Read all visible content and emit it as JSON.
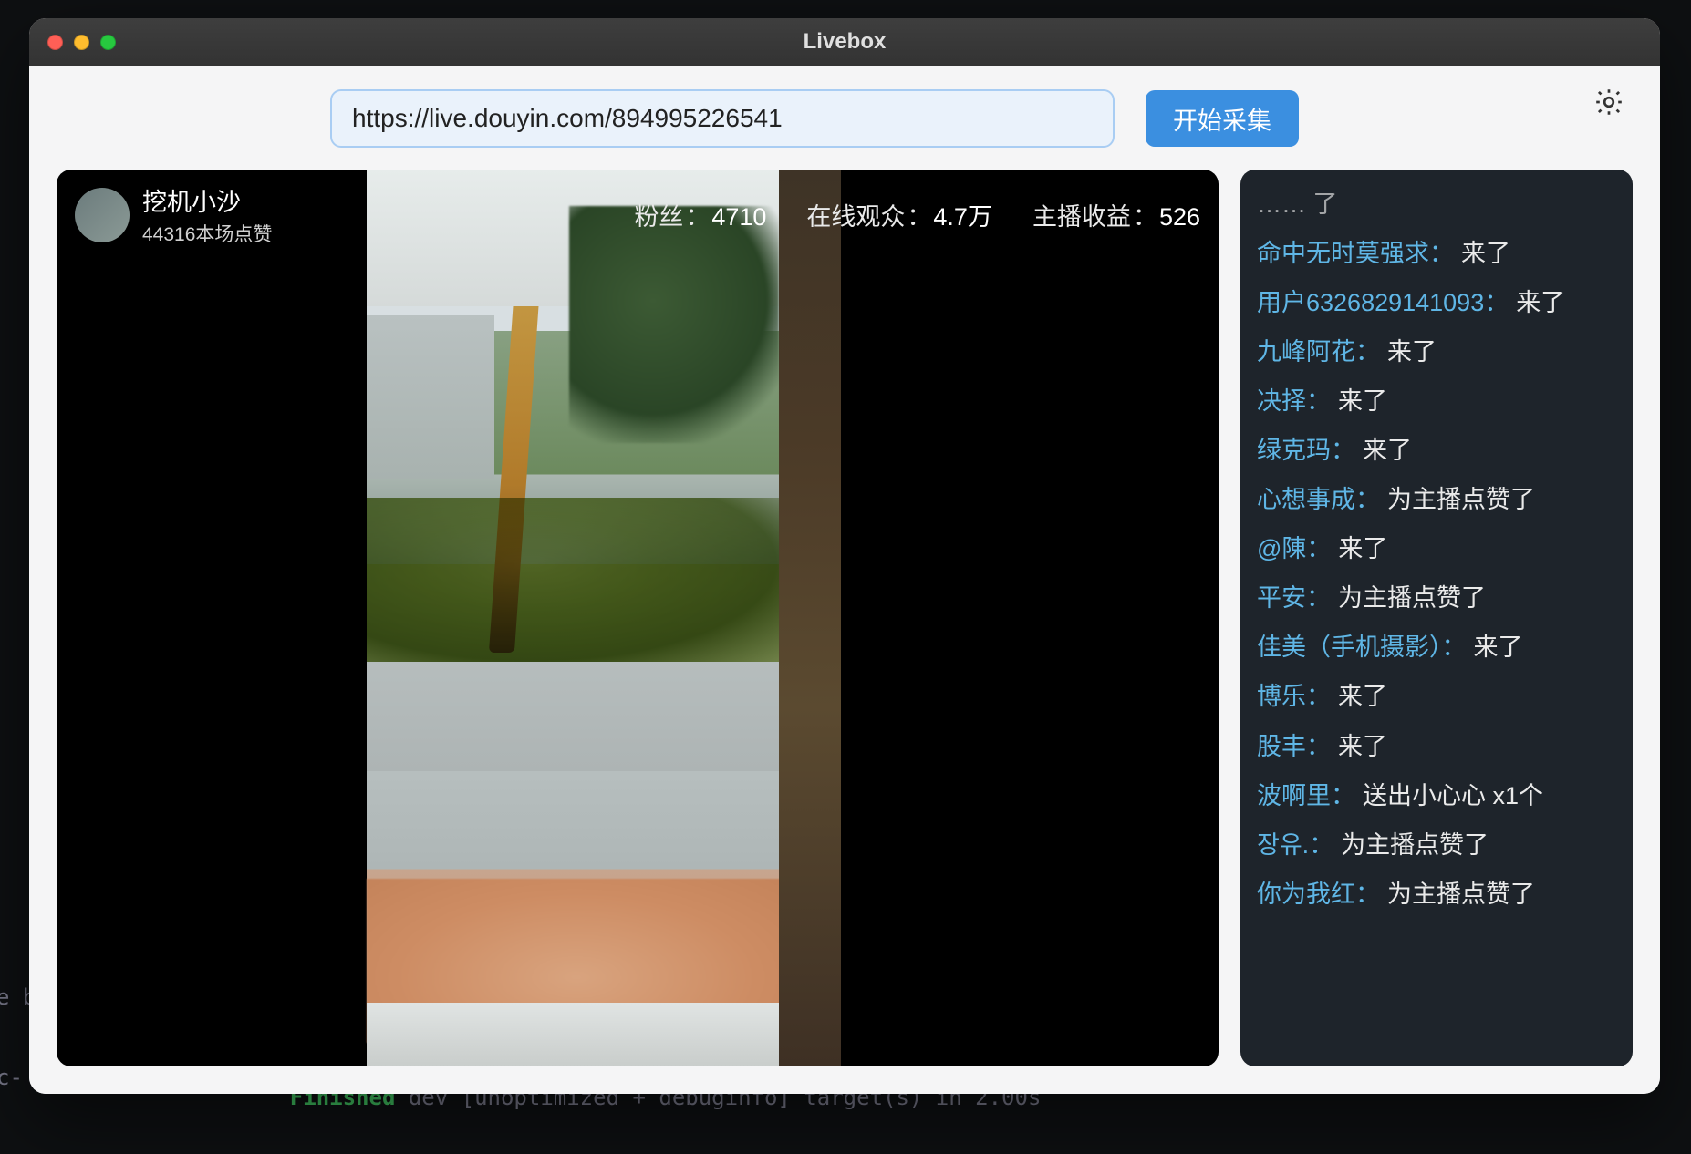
{
  "window": {
    "title": "Livebox"
  },
  "top": {
    "url_value": "https://live.douyin.com/894995226541",
    "start_label": "开始采集"
  },
  "stream": {
    "name": "挖机小沙",
    "subtext": "44316本场点赞",
    "stats": {
      "fans_label": "粉丝",
      "fans_value": "4710",
      "viewers_label": "在线观众",
      "viewers_value": "4.7万",
      "income_label": "主播收益",
      "income_value": "526"
    }
  },
  "chat": {
    "partial_top": "…… 了",
    "messages": [
      {
        "user": "命中无时莫强求",
        "text": "来了"
      },
      {
        "user": "用户6326829141093",
        "text": "来了"
      },
      {
        "user": "九峰阿花",
        "text": "来了"
      },
      {
        "user": "决择",
        "text": "来了"
      },
      {
        "user": "绿克玛",
        "text": "来了"
      },
      {
        "user": "心想事成",
        "text": "为主播点赞了"
      },
      {
        "user": "@陳",
        "text": "来了"
      },
      {
        "user": "平安",
        "text": "为主播点赞了"
      },
      {
        "user": "佳美（手机摄影）",
        "text": "来了"
      },
      {
        "user": "博乐",
        "text": "来了"
      },
      {
        "user": "股丰",
        "text": "来了"
      },
      {
        "user": "波啊里",
        "text": "送出小心心 x1个"
      },
      {
        "user": "장유.",
        "text": "为主播点赞了"
      },
      {
        "user": "你为我红",
        "text": "为主播点赞了"
      }
    ]
  },
  "bg_terminal": {
    "line1_head": "Finished",
    "line1_rest": " dev [unoptimized + debuginfo] target(s) in 2.00s",
    "left1": "e b",
    "left2": "c-"
  }
}
